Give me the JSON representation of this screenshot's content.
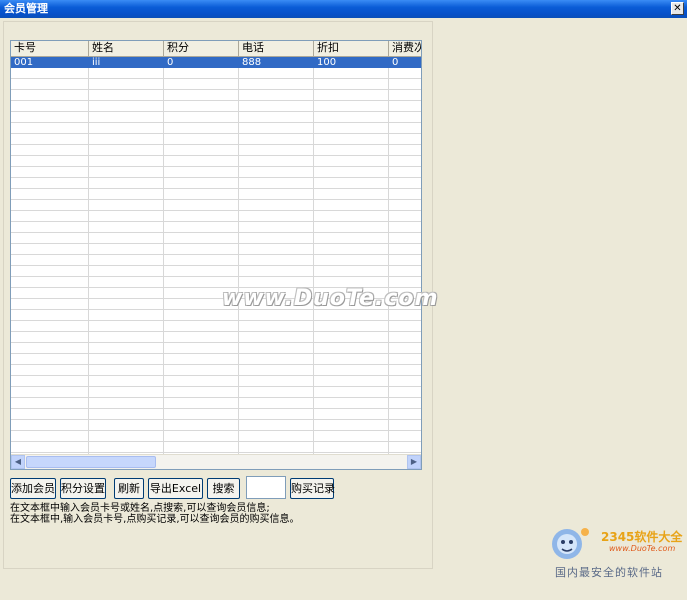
{
  "window": {
    "title": "会员管理",
    "close_glyph": "✕"
  },
  "table": {
    "columns": [
      "卡号",
      "姓名",
      "积分",
      "电话",
      "折扣",
      "消费次"
    ],
    "rows": [
      {
        "card_no": "001",
        "name": "iii",
        "points": "0",
        "phone": "888",
        "discount": "100",
        "count": "0"
      }
    ]
  },
  "toolbar": {
    "add_member": "添加会员",
    "points_settings": "积分设置",
    "refresh": "刷新",
    "export_excel": "导出Excel",
    "search": "搜索",
    "search_value": "",
    "purchase_records": "购买记录"
  },
  "help": {
    "line1": "在文本框中输入会员卡号或姓名,点搜索,可以查询会员信息;",
    "line2": "在文本框中,输入会员卡号,点购买记录,可以查询会员的购买信息。"
  },
  "watermark": "www.DuoTe.com",
  "corner_logo": {
    "brand": "2345软件大全",
    "url": "www.DuoTe.com",
    "slogan": "国内最安全的软件站"
  },
  "colors": {
    "titlebar": "#0a5cd7",
    "selection": "#316ac5",
    "window_bg": "#ece9d8"
  }
}
